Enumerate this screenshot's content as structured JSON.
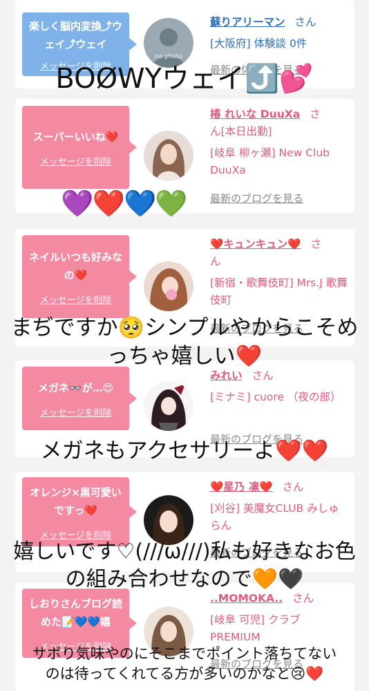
{
  "cards": [
    {
      "message": "楽しく脳内変換⤴︎ウェイ⤴︎ウェイ",
      "delete_label": "メッセージを削除",
      "name": "蘇りアリーマン",
      "honorific": "さん",
      "area": "[大阪府] 体験談 0件",
      "blog_link": "最新の体験談を見る",
      "avatar_text": "no photo"
    },
    {
      "message": "スーパーいいね❤️",
      "delete_label": "メッセージを削除",
      "name": "椿 れいな DuuXa",
      "honorific": "さ",
      "name_cont": "ん[本日出勤]",
      "area": "[岐阜 柳ヶ瀬] New Club DuuXa",
      "blog_link": "最新のブログを見る"
    },
    {
      "message": "ネイルいつも好みなの❤️",
      "delete_label": "メッセージを削除",
      "name": "❤️キュンキュン❤️",
      "honorific": "さ",
      "name_cont": "ん",
      "area": "[新宿・歌舞伎町] Mrs.J 歌舞伎町",
      "blog_link": "最新のブログを見る"
    },
    {
      "message": "メガネ👓が…😍",
      "delete_label": "メッセージを削除",
      "name": "みれい",
      "honorific": "さん",
      "area": "[ミナミ] cuore （夜の部）",
      "blog_link": "最新のブログを見る"
    },
    {
      "message": "オレンジ×黒可愛いですっ❤️",
      "delete_label": "メッセージを削除",
      "name": "❤️星乃 凛❤️",
      "honorific": "さん",
      "area": "[刈谷] 美魔女CLUB みしゅらん",
      "blog_link": "最新のブログを見る"
    },
    {
      "message": "しおりさんブログ読めた📝💙💙嬉",
      "delete_label": "メッセージを削除",
      "name": "..MOMOKA..",
      "honorific": "さん",
      "area": "[岐阜 可児] クラブ PREMIUM",
      "blog_link": "最新のブログを見る"
    }
  ],
  "overlays": {
    "t1": "BOØWYウェイ⤴️💕",
    "t2": "💜❤️💙💚",
    "t3a": "まぢですか🥺シンプルやからこそめ",
    "t3b": "っちゃ嬉しい❤️",
    "t4": "メガネもアクセサリーよ❤️❤️",
    "t5a": "嬉しいです♡(///ω///)私も好きなお色",
    "t5b": "の組み合わせなので🧡🖤",
    "t6a": "サボり気味やのにそこまでポイント落ちてない",
    "t6b": "のは待ってくれてる方が多いのかなと😢❤️"
  },
  "colors": {
    "pink": "#f48aa2",
    "blue": "#7fb2e8",
    "name_pink": "#e15b7c",
    "name_blue": "#2e6fb9"
  }
}
